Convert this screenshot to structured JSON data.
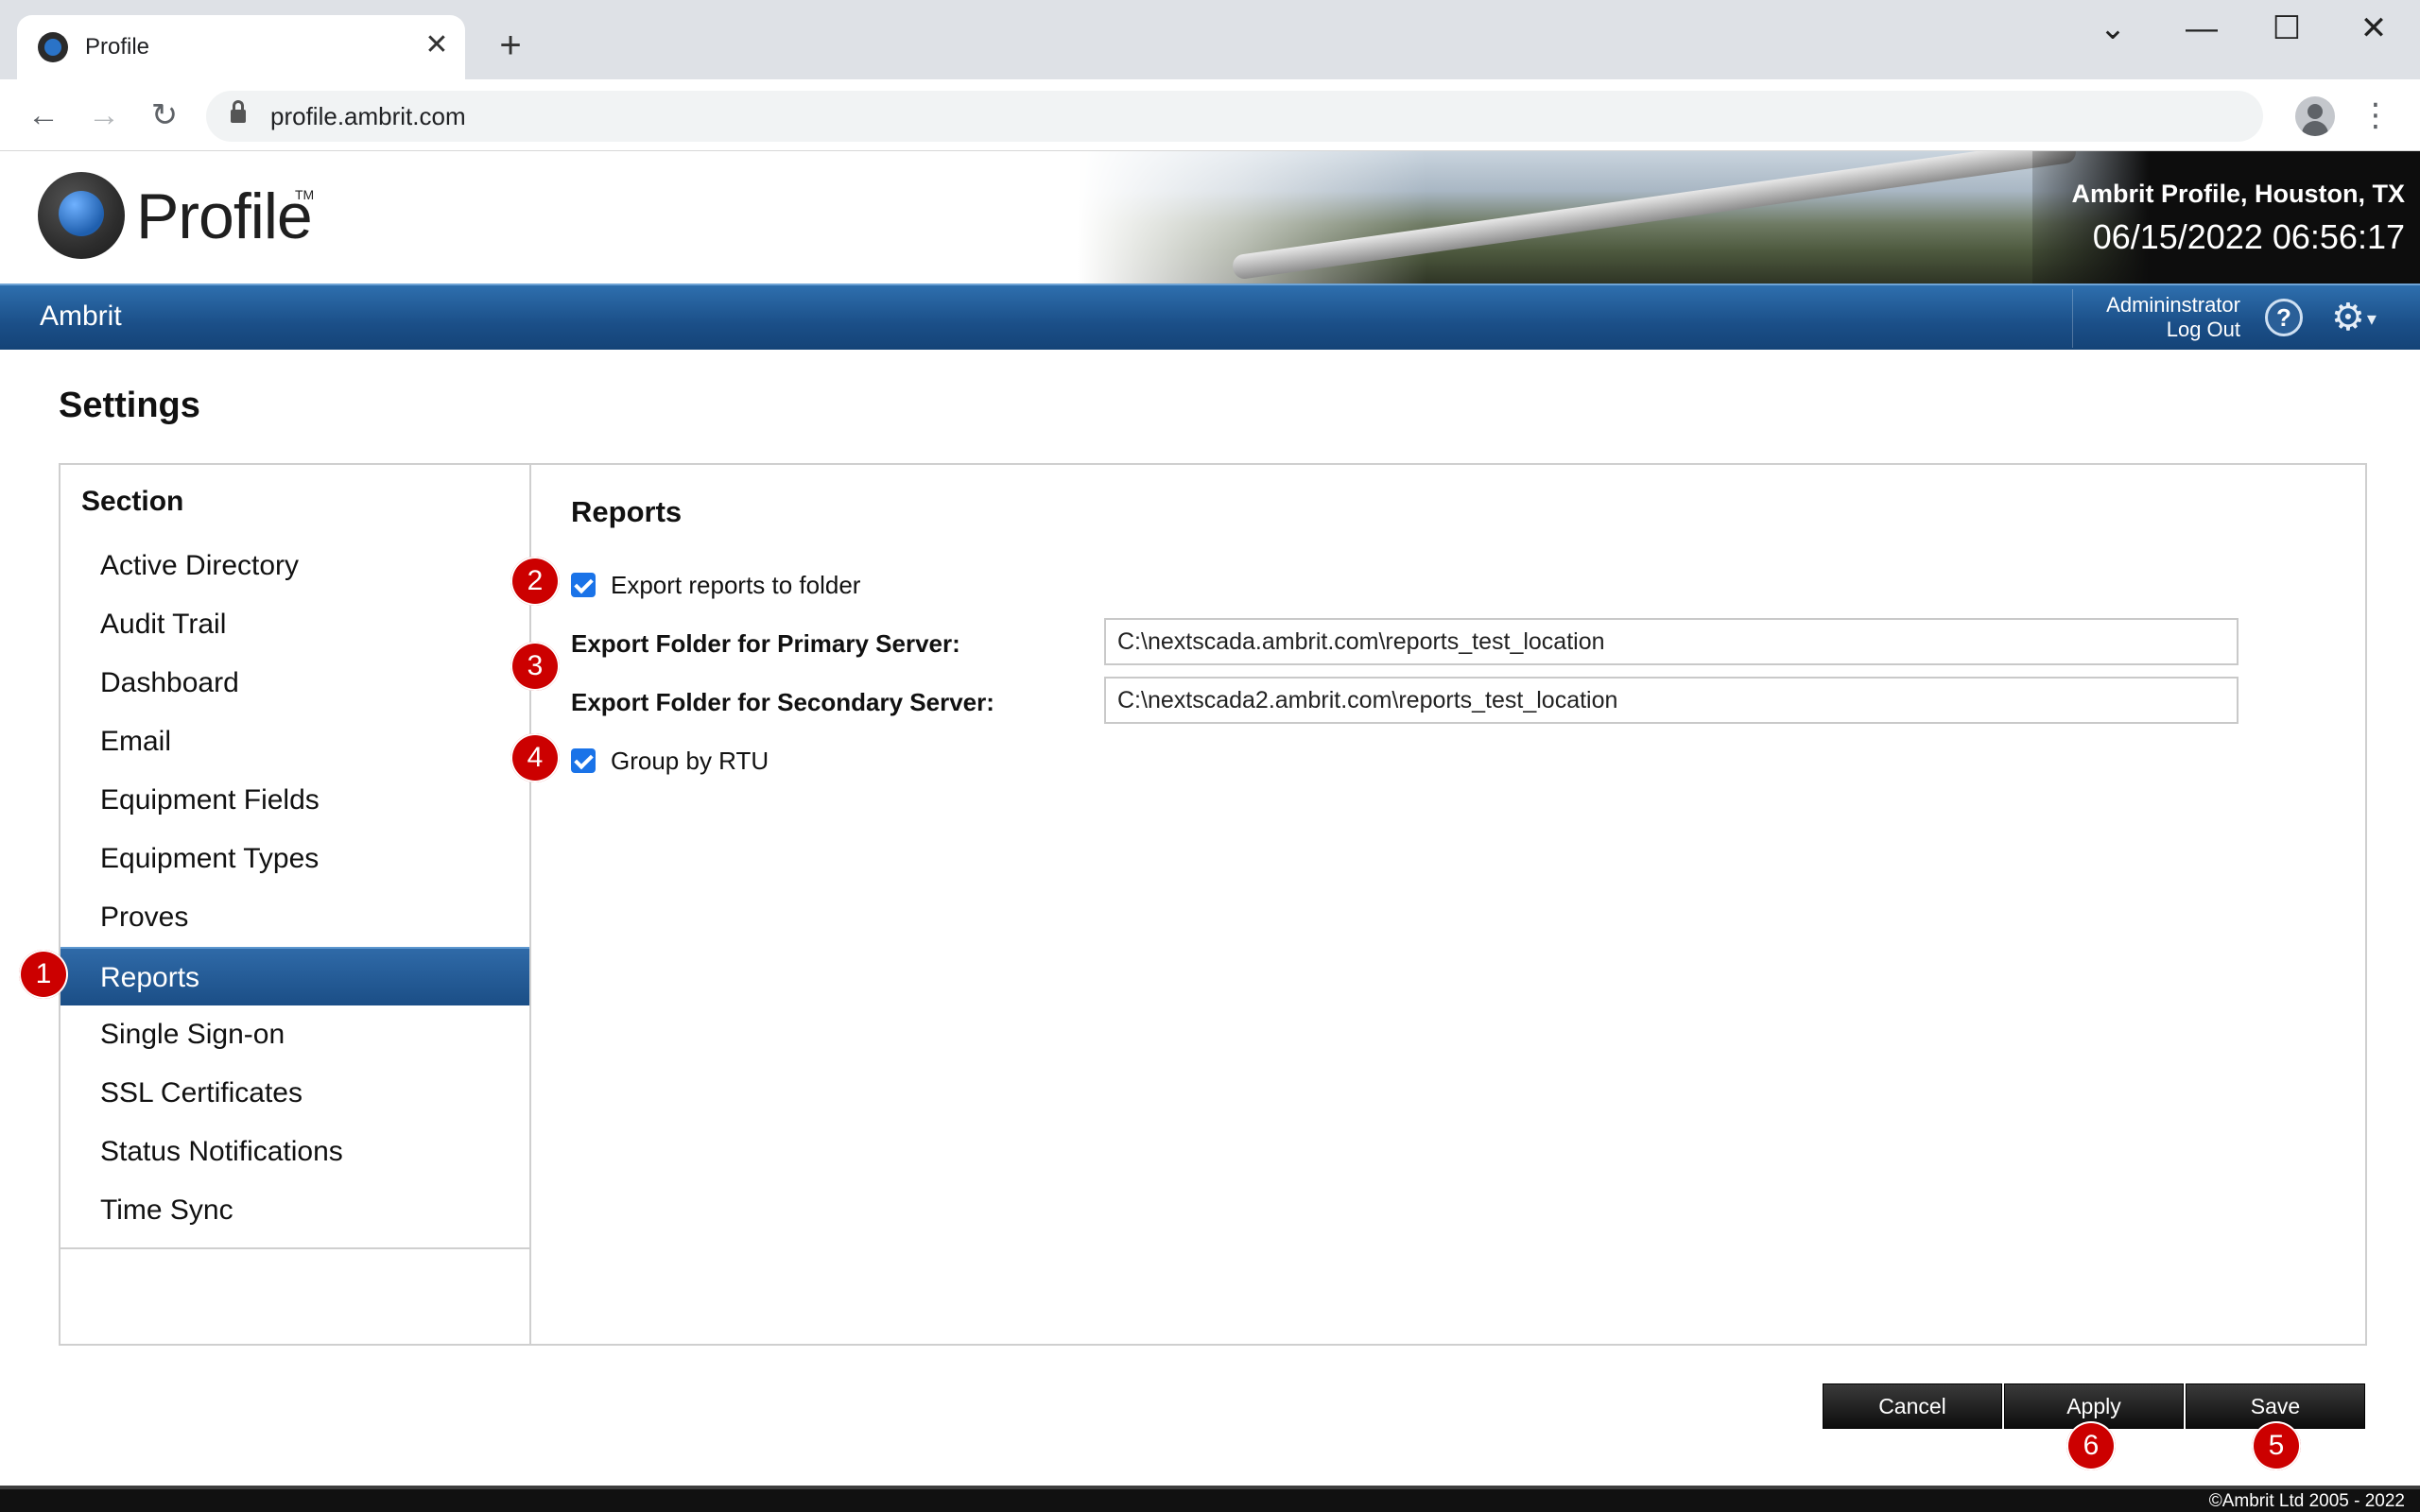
{
  "browser": {
    "tab_title": "Profile",
    "tab_close": "✕",
    "new_tab": "+",
    "url": "profile.ambrit.com",
    "window_controls": {
      "chevron": "⌄",
      "minimize": "—",
      "maximize": "☐",
      "close": "✕"
    },
    "nav": {
      "back": "←",
      "forward": "→",
      "reload": "↻",
      "menu": "⋮"
    }
  },
  "app_header": {
    "logo_text": "Profile",
    "logo_tm": "TM",
    "site_name": "Ambrit Profile, Houston, TX",
    "datetime": "06/15/2022 06:56:17"
  },
  "navbar": {
    "org": "Ambrit",
    "user": "Admininstrator",
    "logout": "Log Out",
    "help": "?",
    "gear": "⚙",
    "gear_caret": "▾"
  },
  "page": {
    "title": "Settings"
  },
  "sidebar": {
    "heading": "Section",
    "items": [
      {
        "label": "Active Directory"
      },
      {
        "label": "Audit Trail"
      },
      {
        "label": "Dashboard"
      },
      {
        "label": "Email"
      },
      {
        "label": "Equipment Fields"
      },
      {
        "label": "Equipment Types"
      },
      {
        "label": "Proves"
      },
      {
        "label": "Reports"
      },
      {
        "label": "Single Sign-on"
      },
      {
        "label": "SSL Certificates"
      },
      {
        "label": "Status Notifications"
      },
      {
        "label": "Time Sync"
      }
    ],
    "active_item": "Reports"
  },
  "reports": {
    "title": "Reports",
    "export_checkbox_label": "Export reports to folder",
    "primary_label": "Export Folder for Primary Server:",
    "primary_value": "C:\\nextscada.ambrit.com\\reports_test_location",
    "secondary_label": "Export Folder for Secondary Server:",
    "secondary_value": "C:\\nextscada2.ambrit.com\\reports_test_location",
    "group_checkbox_label": "Group by RTU"
  },
  "buttons": {
    "cancel": "Cancel",
    "apply": "Apply",
    "save": "Save"
  },
  "callouts": [
    "1",
    "2",
    "3",
    "4",
    "5",
    "6"
  ],
  "footer": {
    "copyright": "©Ambrit Ltd 2005 - 2022"
  },
  "colors": {
    "nav_blue": "#1b4f88",
    "callout_red": "#cc0000",
    "checkbox_blue": "#1a73e8"
  }
}
